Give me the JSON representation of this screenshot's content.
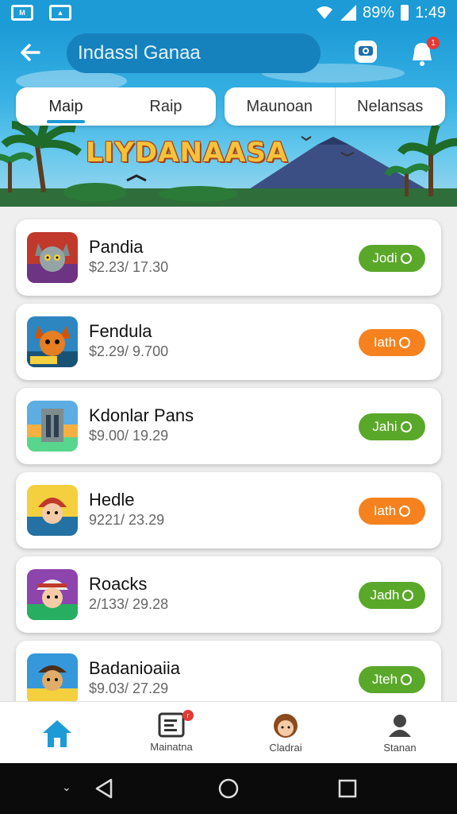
{
  "status_bar": {
    "battery_text": "89%",
    "time": "1:49"
  },
  "header": {
    "search_text": "Indassl Ganaa",
    "bell_badge": "1"
  },
  "banner": {
    "title": "LIYDANAASA"
  },
  "tabs": {
    "left": [
      "Maip",
      "Raip"
    ],
    "right": [
      "Maunoan",
      "Nelansas"
    ]
  },
  "items": [
    {
      "name": "Pandia",
      "price": "$2.23/ 17.30",
      "button": "Jodi",
      "color": "#5aa82a",
      "icon": "cat-character-icon"
    },
    {
      "name": "Fendula",
      "price": "$2.29/ 9.700",
      "button": "Iath",
      "color": "#f5821f",
      "icon": "fox-character-icon"
    },
    {
      "name": "Kdonlar Pans",
      "price": "$9.00/ 19.29",
      "button": "Jahi",
      "color": "#5aa82a",
      "icon": "building-icon"
    },
    {
      "name": "Hedle",
      "price": "9221/ 23.29",
      "button": "Iath",
      "color": "#f5821f",
      "icon": "warrior-character-icon"
    },
    {
      "name": "Roacks",
      "price": "2/133/ 29.28",
      "button": "Jadh",
      "color": "#5aa82a",
      "icon": "elf-character-icon"
    },
    {
      "name": "Badanioaiia",
      "price": "$9.03/ 27.29",
      "button": "Jteh",
      "color": "#5aa82a",
      "icon": "pirate-character-icon"
    }
  ],
  "bottom_nav": [
    {
      "label": "",
      "icon": "home-icon"
    },
    {
      "label": "Mainatna",
      "icon": "news-icon",
      "badge": "r"
    },
    {
      "label": "Cladrai",
      "icon": "avatar-icon"
    },
    {
      "label": "Stanan",
      "icon": "profile-icon"
    }
  ],
  "colors": {
    "primary": "#1c9bd6",
    "green": "#5aa82a",
    "orange": "#f5821f"
  }
}
